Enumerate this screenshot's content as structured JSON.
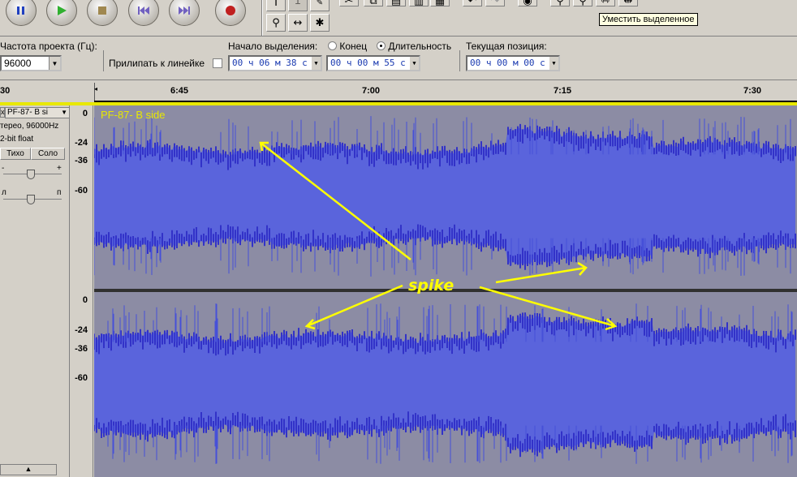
{
  "toolbar": {
    "buttons": [
      "pause-icon",
      "play-icon",
      "stop-icon",
      "skip-start-icon",
      "skip-end-icon",
      "record-icon"
    ],
    "tools": [
      "selection-tool-icon",
      "envelope-tool-icon",
      "draw-tool-icon",
      "zoom-tool-icon",
      "timeshift-tool-icon",
      "multi-tool-icon"
    ],
    "tooltip": "Уместить выделенное"
  },
  "selection_bar": {
    "rate_label": "Частота проекта (Гц):",
    "rate_value": "96000",
    "snap_label": "Прилипать к линейке",
    "sel_start_label": "Начало выделения:",
    "end_label": "Конец",
    "length_label": "Длительность",
    "pos_label": "Текущая позиция:",
    "sel_start_value": "00 ч 06 м 38 с",
    "sel_length_value": "00 ч 00 м 55 с",
    "pos_value": "00 ч 00 м 00 с"
  },
  "ruler": {
    "left_label": "30",
    "ticks": [
      "6:45",
      "7:00",
      "7:15",
      "7:30"
    ]
  },
  "track": {
    "name": "PF-87- B si",
    "info1": "терео, 96000Hz",
    "info2": "2-bit float",
    "mute": "Тихо",
    "solo": "Соло",
    "gain_minus": "-",
    "gain_plus": "+",
    "pan_left": "л",
    "pan_right": "п",
    "title_in_wave": "PF-87- B side",
    "db_labels": [
      "0",
      "-24",
      "-36",
      "-60"
    ]
  },
  "annotation": {
    "text": "spike",
    "color": "#ffff00"
  },
  "colors": {
    "wave": "#3232c8",
    "wave_bg": "#5a64dc",
    "track_bg": "#8c8ca4"
  }
}
